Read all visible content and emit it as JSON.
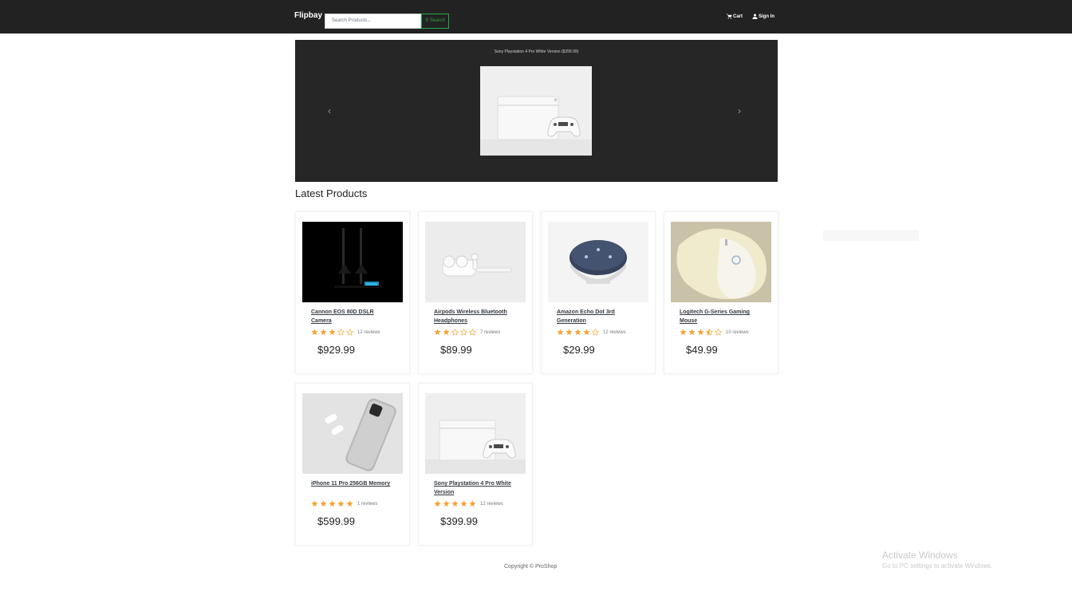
{
  "navbar": {
    "brand": "Flipbay",
    "search_placeholder": "Search Products...",
    "search_button": "Search",
    "cart_label": "Cart",
    "signin_label": "Sign In"
  },
  "carousel": {
    "caption": "Sony Playstation 4 Pro White Version ($399.99)",
    "prev_glyph": "‹",
    "next_glyph": "›"
  },
  "latest_heading": "Latest Products",
  "products": [
    {
      "name": "Cannon EOS 80D DSLR Camera",
      "rating": 3,
      "reviews": "12 reviews",
      "price": "$929.99",
      "image": "camera"
    },
    {
      "name": "Airpods Wireless Bluetooth Headphones",
      "rating": 2,
      "reviews": "7 reviews",
      "price": "$89.99",
      "image": "airpods"
    },
    {
      "name": "Amazon Echo Dot 3rd Generation",
      "rating": 4,
      "reviews": "12 reviews",
      "price": "$29.99",
      "image": "echo"
    },
    {
      "name": "Logitech G-Series Gaming Mouse",
      "rating": 3.5,
      "reviews": "10 reviews",
      "price": "$49.99",
      "image": "mouse"
    },
    {
      "name": "iPhone 11 Pro 256GB Memory",
      "rating": 5,
      "reviews": "1 reviews",
      "price": "$599.99",
      "image": "iphone"
    },
    {
      "name": "Sony Playstation 4 Pro White Version",
      "rating": 5,
      "reviews": "12 reviews",
      "price": "$399.99",
      "image": "ps4"
    }
  ],
  "footer": "Copyright © ProShop",
  "watermark": {
    "title": "Activate Windows",
    "subtitle": "Go to PC settings to activate Windows."
  },
  "colors": {
    "navbar_bg": "#222222",
    "carousel_bg": "#262626",
    "star_color": "#f8a233",
    "search_accent": "#28a745"
  }
}
